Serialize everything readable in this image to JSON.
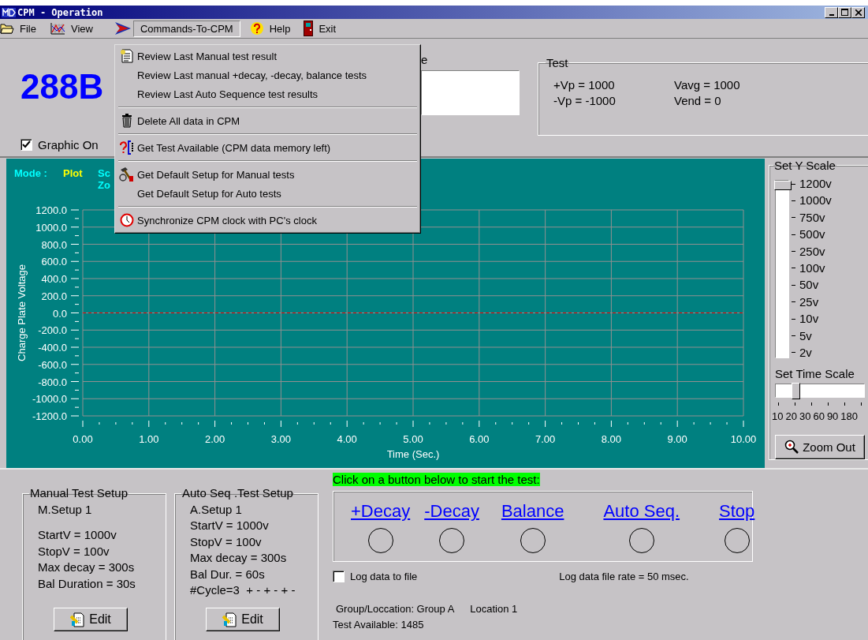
{
  "window": {
    "title": "CPM - Operation"
  },
  "menu_bar": [
    {
      "label": "File",
      "selected": false
    },
    {
      "label": "View",
      "selected": false
    },
    {
      "label": "Commands-To-CPM",
      "selected": true
    },
    {
      "label": "Help",
      "selected": false
    },
    {
      "label": "Exit",
      "selected": false
    }
  ],
  "commands_menu": {
    "groups": [
      [
        "Review Last Manual test result",
        "Review Last manual +decay, -decay, balance tests",
        "Review Last Auto Sequence test results"
      ],
      [
        "Delete All data in CPM"
      ],
      [
        "Get Test Available (CPM data memory left)"
      ],
      [
        "Get Default Setup for Manual tests",
        "Get Default Setup for Auto tests"
      ],
      [
        "Synchronize CPM clock with PC's clock"
      ]
    ]
  },
  "device_model": "288B",
  "graphic_on": {
    "label": "Graphic On",
    "checked": true
  },
  "field_label_fragment": "e",
  "test_readings": {
    "title": "Test",
    "values": [
      "+Vp = 1000",
      "Vavg = 1000",
      "-Vp = -1000",
      "Vend = 0"
    ]
  },
  "plot": {
    "mode_label": "Mode :",
    "mode_value": "Plot",
    "obscured_labels": [
      "Sc",
      "Zo"
    ],
    "chart_data": {
      "type": "line",
      "xlabel": "Time (Sec.)",
      "ylabel": "Charge Plate Voltage",
      "xlim": [
        0,
        10
      ],
      "ylim": [
        -1200,
        1200
      ],
      "xticks": [
        {
          "value": 0,
          "label": "0.00"
        },
        {
          "value": 1,
          "label": "1.00"
        },
        {
          "value": 2,
          "label": "2.00"
        },
        {
          "value": 3,
          "label": "3.00"
        },
        {
          "value": 4,
          "label": "4.00"
        },
        {
          "value": 5,
          "label": "5.00"
        },
        {
          "value": 6,
          "label": "6.00"
        },
        {
          "value": 7,
          "label": "7.00"
        },
        {
          "value": 8,
          "label": "8.00"
        },
        {
          "value": 9,
          "label": "9.00"
        },
        {
          "value": 10,
          "label": "10.00"
        }
      ],
      "yticks": [
        {
          "value": 1200,
          "label": "1200.0"
        },
        {
          "value": 1000,
          "label": "1000.0"
        },
        {
          "value": 800,
          "label": "800.0"
        },
        {
          "value": 600,
          "label": "600.0"
        },
        {
          "value": 400,
          "label": "400.0"
        },
        {
          "value": 200,
          "label": "200.0"
        },
        {
          "value": 0,
          "label": "0.0"
        },
        {
          "value": -200,
          "label": "-200.0"
        },
        {
          "value": -400,
          "label": "-400.0"
        },
        {
          "value": -600,
          "label": "-600.0"
        },
        {
          "value": -800,
          "label": "-800.0"
        },
        {
          "value": -1000,
          "label": "-1000.0"
        },
        {
          "value": -1200,
          "label": "-1200.0"
        }
      ],
      "x": [
        0,
        10
      ],
      "grid": true,
      "series": [
        {
          "color": "#ff0000",
          "line_style": "dashed",
          "values": [
            0,
            0
          ]
        }
      ]
    }
  },
  "y_scale": {
    "title": "Set Y Scale",
    "level": 1,
    "labels": [
      "1200v",
      "1000v",
      "750v",
      "500v",
      "250v",
      "100v",
      "50v",
      "25v",
      "10v",
      "5v",
      "2v"
    ]
  },
  "time_scale": {
    "title": "Set Time Scale",
    "level": 0.2,
    "labels": [
      "10",
      "20",
      "30",
      "60",
      "90",
      "180"
    ]
  },
  "zoom_out_button": "Zoom Out",
  "manual_setup": {
    "title": "Manual Test Setup",
    "name": "M.Setup 1",
    "lines": [
      "StartV = 1000v",
      "StopV = 100v",
      "Max decay = 300s",
      "Bal Duration = 30s"
    ],
    "edit_button": "Edit"
  },
  "auto_setup": {
    "title": "Auto Seq .Test Setup",
    "name": "A.Setup 1",
    "lines": [
      "StartV = 1000v",
      "StopV = 100v",
      "Max decay = 300s",
      "Bal Dur. = 60s",
      "#Cycle=3  + - + - + -"
    ],
    "edit_button": "Edit"
  },
  "start_prompt": "Click on a button below to start the test:",
  "test_buttons": [
    "+Decay",
    "-Decay",
    "Balance",
    "Auto Seq.",
    "Stop"
  ],
  "log_to_file": {
    "label": "Log data to file",
    "checked": false
  },
  "log_rate": "Log data file rate = 50 msec.",
  "group_location": {
    "group": "Group/Loccation: Group A",
    "location": "Location 1"
  },
  "test_available": "Test Available: 1485"
}
